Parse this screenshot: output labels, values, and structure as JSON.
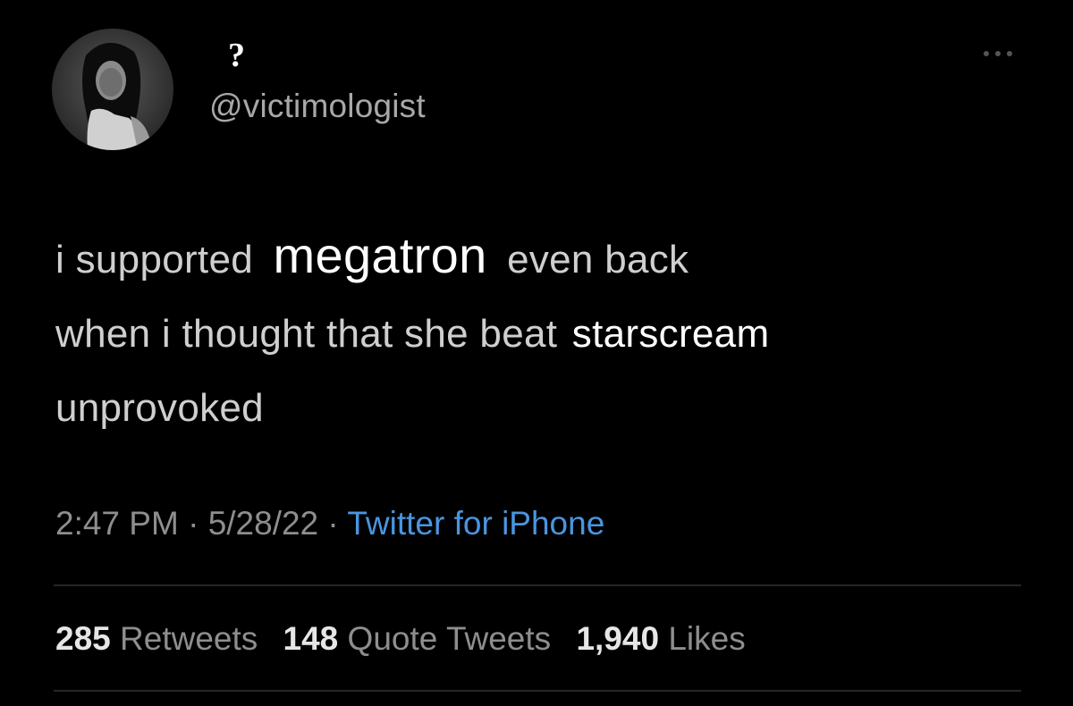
{
  "tweet": {
    "display_name": "?",
    "handle": "@victimologist",
    "text": {
      "line1_a": "i supported",
      "line1_highlight": "megatron",
      "line1_b": "even back",
      "line2_a": "when i thought that she beat",
      "line2_highlight": "starscream",
      "line3": "unprovoked"
    },
    "time": "2:47 PM",
    "date": "5/28/22",
    "separator": "·",
    "source": "Twitter for iPhone",
    "stats": {
      "retweets_count": "285",
      "retweets_label": "Retweets",
      "quotes_count": "148",
      "quotes_label": "Quote Tweets",
      "likes_count": "1,940",
      "likes_label": "Likes"
    }
  },
  "colors": {
    "background": "#000000",
    "text": "#cfcfcf",
    "muted": "#8e8e8e",
    "link": "#4a95e0"
  },
  "icons": {
    "more": "more-options-icon",
    "avatar": "avatar"
  }
}
